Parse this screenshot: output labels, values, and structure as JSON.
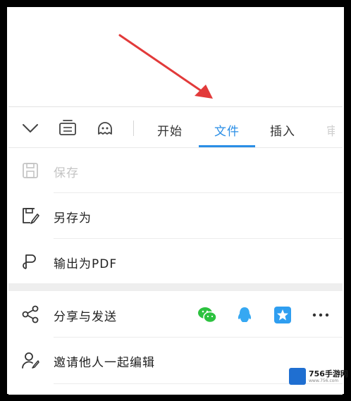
{
  "toolbar": {
    "icons": [
      "chevron-down-icon",
      "keyboard-icon",
      "voice-assistant-icon"
    ],
    "tabs": [
      {
        "label": "开始"
      },
      {
        "label": "文件"
      },
      {
        "label": "插入"
      },
      {
        "label": "审"
      }
    ],
    "active_tab": "文件",
    "accent_color": "#2a8ee6"
  },
  "menu": {
    "items": [
      {
        "label": "保存",
        "icon": "save-icon",
        "disabled": true
      },
      {
        "label": "另存为",
        "icon": "save-as-icon",
        "disabled": false
      },
      {
        "label": "输出为PDF",
        "icon": "pdf-export-icon",
        "disabled": false
      }
    ],
    "share": {
      "label": "分享与发送",
      "icon": "share-icon",
      "targets": [
        "wechat-icon",
        "qq-icon",
        "qzone-icon",
        "more-icon"
      ]
    },
    "invite": {
      "label": "邀请他人一起编辑",
      "icon": "invite-edit-icon"
    }
  },
  "annotation": {
    "color": "#e23a3a"
  },
  "watermark": {
    "title": "756手游网",
    "subtitle": "www.756.com"
  }
}
